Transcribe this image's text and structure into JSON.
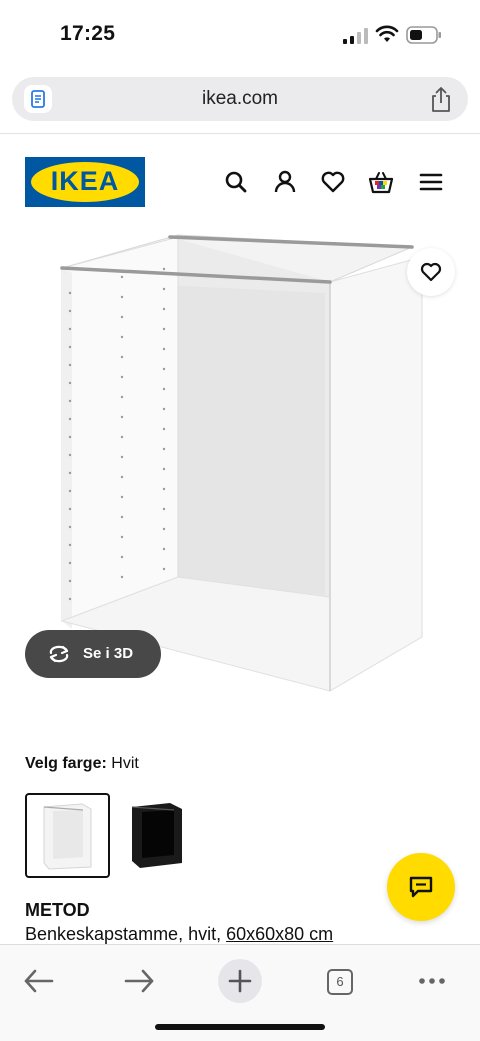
{
  "status": {
    "time": "17:25"
  },
  "browser": {
    "url": "ikea.com",
    "tab_count": "6"
  },
  "header": {
    "logo_text": "IKEA",
    "icons": [
      "search-icon",
      "user-icon",
      "heart-icon",
      "basket-icon",
      "menu-icon"
    ]
  },
  "product": {
    "view_3d_label": "Se i 3D",
    "color_label": "Velg farge:",
    "color_value": "Hvit",
    "name": "METOD",
    "description": "Benkeskapstamme, hvit, ",
    "size": "60x60x80 cm"
  },
  "colors": {
    "accent_yellow": "#ffdb00",
    "brand_blue": "#0058a3"
  }
}
